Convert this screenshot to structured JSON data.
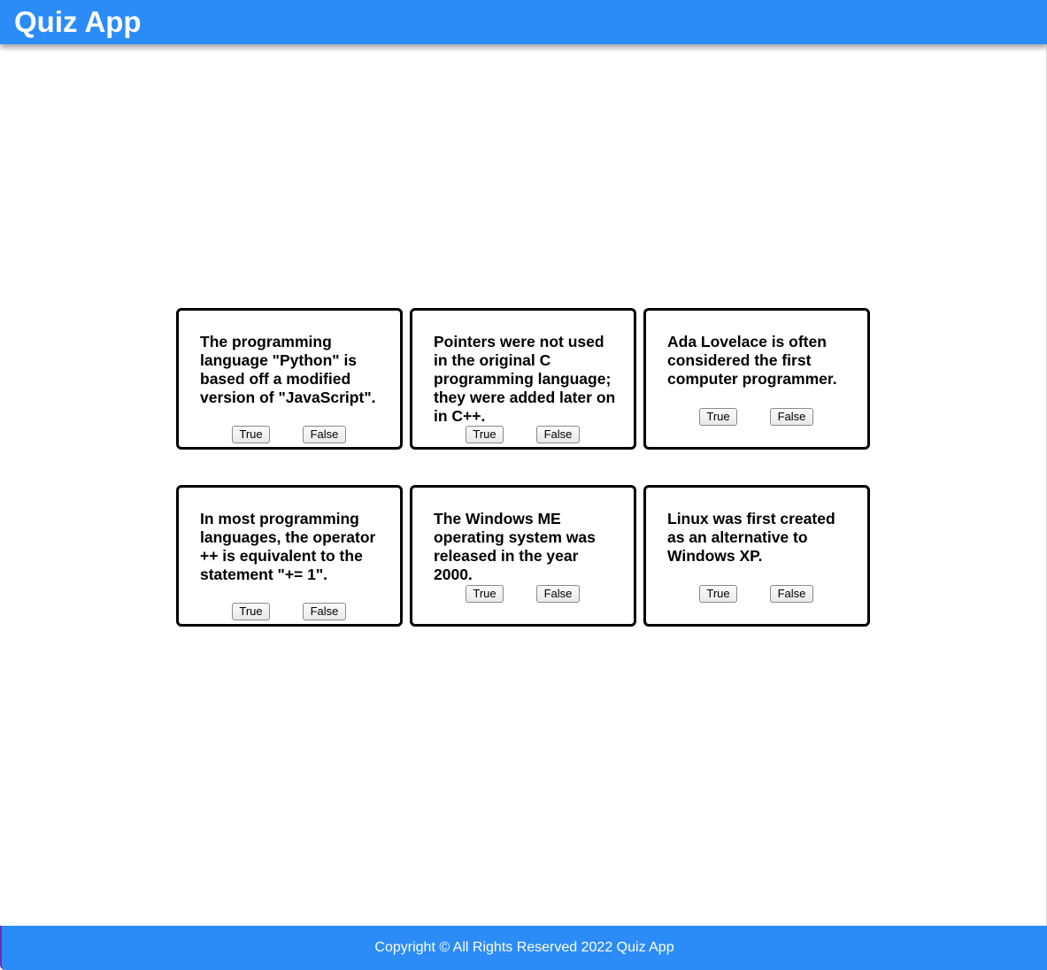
{
  "header": {
    "title": "Quiz App"
  },
  "questions": [
    {
      "text": "The programming language \"Python\" is based off a modified version of \"JavaScript\".",
      "true_label": "True",
      "false_label": "False"
    },
    {
      "text": "Pointers were not used in the original C programming language; they were added later on in C++.",
      "true_label": "True",
      "false_label": "False"
    },
    {
      "text": "Ada Lovelace is often considered the first computer programmer.",
      "true_label": "True",
      "false_label": "False"
    },
    {
      "text": "In most programming languages, the operator ++ is equivalent to the statement \"+= 1\".",
      "true_label": "True",
      "false_label": "False"
    },
    {
      "text": "The Windows ME operating system was released in the year 2000.",
      "true_label": "True",
      "false_label": "False"
    },
    {
      "text": "Linux was first created as an alternative to Windows XP.",
      "true_label": "True",
      "false_label": "False"
    }
  ],
  "footer": {
    "copyright": "Copyright © All Rights Reserved 2022 Quiz App"
  },
  "colors": {
    "header_bg": "#2b8cf7",
    "footer_bg": "#2b8cf7",
    "card_border": "#000000",
    "text_on_brand": "#ffffff"
  }
}
